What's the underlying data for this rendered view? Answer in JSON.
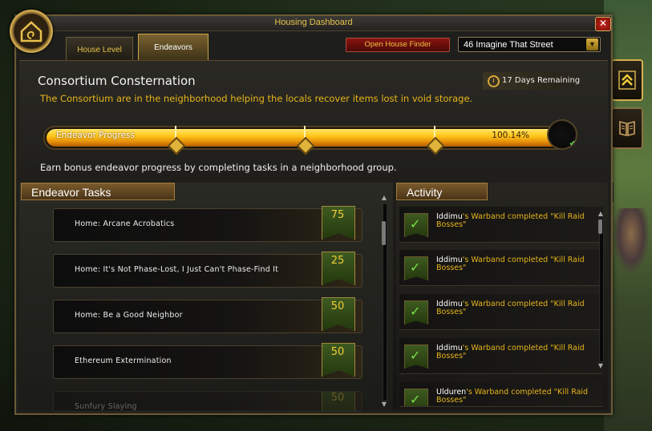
{
  "window": {
    "title": "Housing Dashboard",
    "close_label": "✕"
  },
  "tabs": [
    {
      "label": "House Level",
      "selected": false
    },
    {
      "label": "Endeavors",
      "selected": true
    }
  ],
  "toolbar": {
    "open_finder_label": "Open House Finder",
    "street_selected": "46 Imagine That Street",
    "dropdown_arrow": "▼"
  },
  "endeavor": {
    "title": "Consortium Consternation",
    "description": "The Consortium are in the neighborhood helping the locals recover items lost in void storage.",
    "time_remaining": "17 Days Remaining",
    "progress_label": "Endeavor Progress",
    "progress_percent_text": "100.14%",
    "progress_value": 1.0,
    "milestones": [
      0.25,
      0.5,
      0.75
    ],
    "bonus_text": "Earn bonus endeavor progress by completing tasks in a neighborhood group."
  },
  "tasks": {
    "header": "Endeavor Tasks",
    "items": [
      {
        "name": "Home: Arcane Acrobatics",
        "points": "75"
      },
      {
        "name": "Home: It's Not Phase-Lost, I Just Can't Phase-Find It",
        "points": "25"
      },
      {
        "name": "Home: Be a Good Neighbor",
        "points": "50"
      },
      {
        "name": "Ethereum Extermination",
        "points": "50"
      },
      {
        "name": "Sunfury Slaying",
        "points": "50"
      }
    ]
  },
  "activity": {
    "header": "Activity",
    "items": [
      {
        "user": "Iddimu",
        "text": "'s Warband completed \"Kill Raid Bosses\""
      },
      {
        "user": "Iddimu",
        "text": "'s Warband completed \"Kill Raid Bosses\""
      },
      {
        "user": "Iddimu",
        "text": "'s Warband completed \"Kill Raid Bosses\""
      },
      {
        "user": "Iddimu",
        "text": "'s Warband completed \"Kill Raid Bosses\""
      },
      {
        "user": "Ulduren",
        "text": "'s Warband completed \"Kill Raid Bosses\""
      }
    ]
  },
  "icons": {
    "emblem": "house-emblem-icon",
    "side_buttons": [
      "upgrade-chevrons-icon",
      "book-icon"
    ],
    "check": "check-icon"
  },
  "colors": {
    "gold_text": "#e8b51a",
    "title_gold": "#e8c14a",
    "progress_gold": "#ffc61a",
    "task_banner_green": "#3e5a20"
  }
}
